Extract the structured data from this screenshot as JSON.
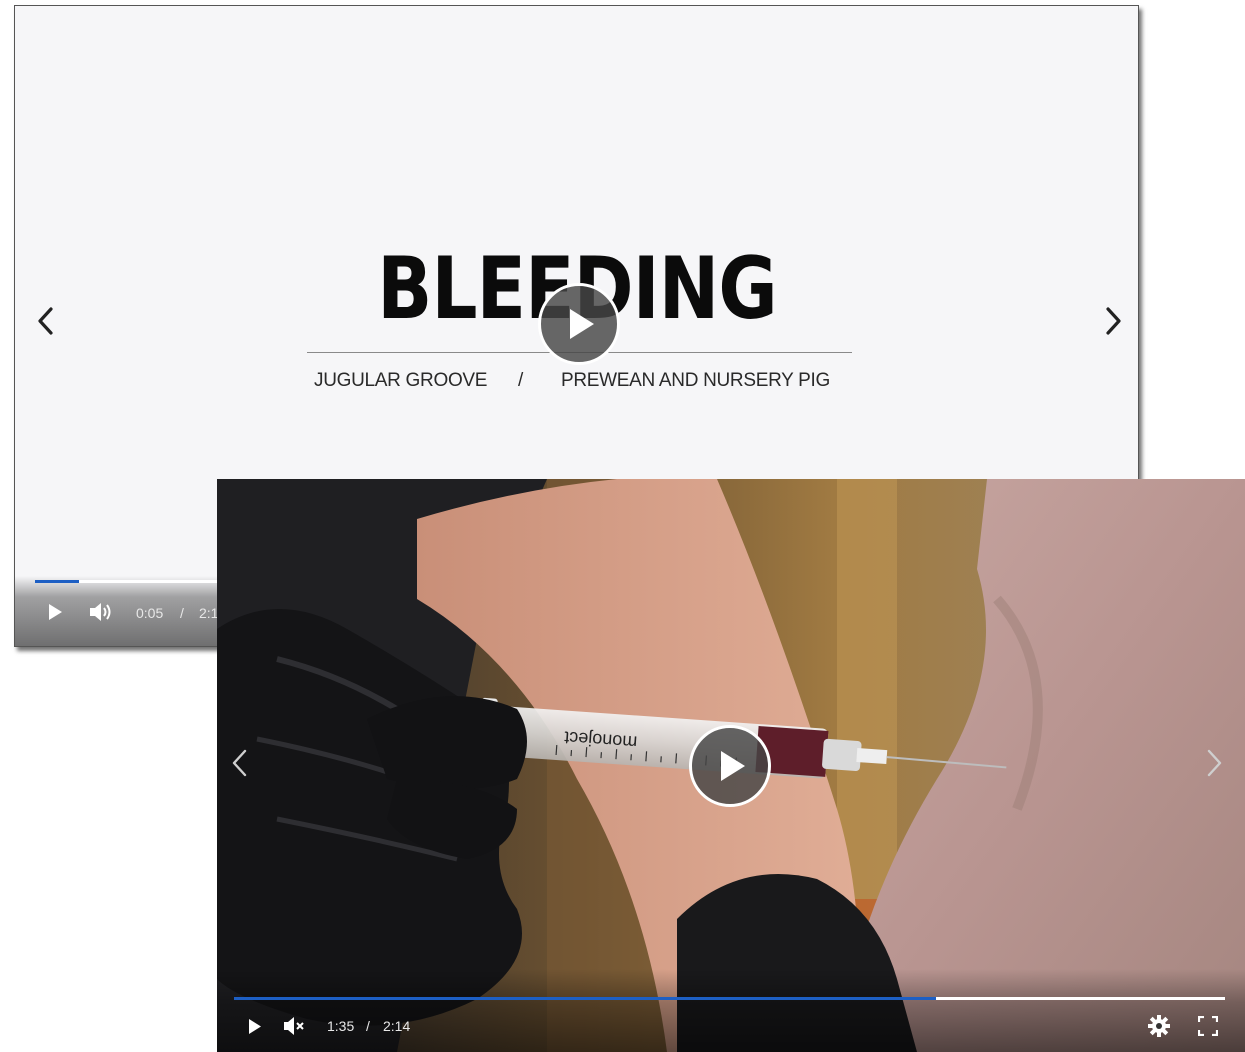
{
  "back_player": {
    "title": "BLEEDING",
    "subtitle_left": "JUGULAR GROOVE",
    "subtitle_separator": "/",
    "subtitle_right": "PREWEAN AND NURSERY PIG",
    "current_time": "0:05",
    "time_separator": "/",
    "duration_partial": "2:1",
    "progress": 0.04,
    "icons": {
      "prev": "chevron-left-icon",
      "next": "chevron-right-icon",
      "play": "play-icon",
      "volume": "volume-icon"
    }
  },
  "front_player": {
    "syringe_label": "monoject",
    "current_time": "1:35",
    "time_separator": "/",
    "duration": "2:14",
    "progress": 0.708,
    "icons": {
      "prev": "chevron-left-icon",
      "next": "chevron-right-icon",
      "play": "play-icon",
      "mute": "volume-muted-icon",
      "settings": "gear-icon",
      "fullscreen": "fullscreen-icon"
    }
  },
  "colors": {
    "progress_fill": "#1d5fc4",
    "progress_track": "#ffffff",
    "title_card_bg": "#f6f6f8"
  }
}
